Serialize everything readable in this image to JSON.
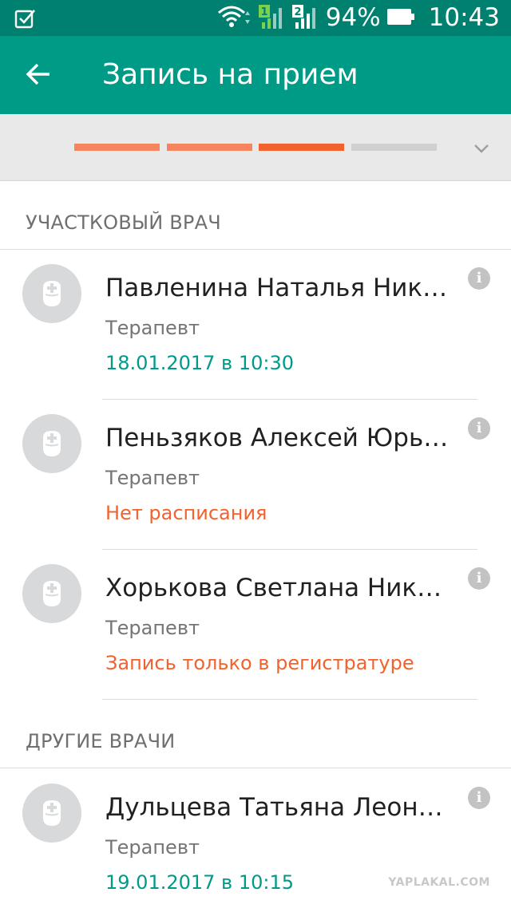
{
  "status_bar": {
    "battery": "94%",
    "time": "10:43"
  },
  "app_bar": {
    "title": "Запись на прием"
  },
  "progress": {
    "steps_total": 4,
    "steps_done": 3,
    "colors": {
      "done": "#f4855e",
      "current": "#f2622e",
      "pending": "#d0d0d0"
    }
  },
  "sections": {
    "district": {
      "title": "УЧАСТКОВЫЙ ВРАЧ",
      "doctors": [
        {
          "name": "Павленина Наталья Ник…",
          "specialty": "Терапевт",
          "status": "18.01.2017 в 10:30"
        },
        {
          "name": "Пеньзяков Алексей Юрь…",
          "specialty": "Терапевт",
          "status": "Нет расписания"
        },
        {
          "name": "Хорькова Светлана Ник…",
          "specialty": "Терапевт",
          "status": "Запись только в регистратуре"
        }
      ]
    },
    "other": {
      "title": "ДРУГИЕ ВРАЧИ",
      "doctors": [
        {
          "name": "Дульцева Татьяна Леон…",
          "specialty": "Терапевт",
          "status": "19.01.2017 в 10:15"
        }
      ]
    }
  },
  "info_glyph": "i",
  "watermark": "YAPLAKAL.COM",
  "colors": {
    "status_bar": "#00806f",
    "app_bar": "#009b86",
    "available": "#00998a",
    "unavailable": "#f2622e"
  }
}
